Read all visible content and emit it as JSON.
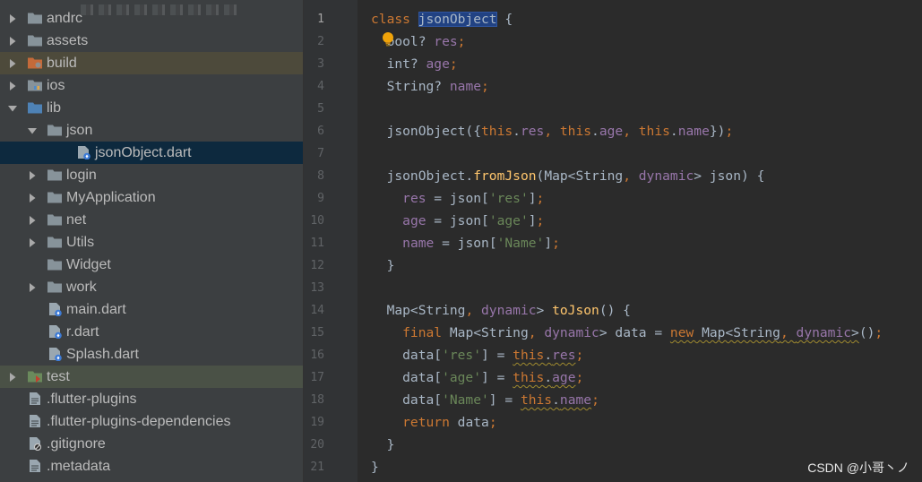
{
  "project_tree": {
    "items": [
      {
        "label": "andrc",
        "arrow": "collapsed",
        "icon": "folder-icon",
        "indent": 0
      },
      {
        "label": "assets",
        "arrow": "collapsed",
        "icon": "folder-icon",
        "indent": 0
      },
      {
        "label": "build",
        "arrow": "collapsed",
        "icon": "excluded-folder-icon",
        "indent": 0,
        "state": "build"
      },
      {
        "label": "ios",
        "arrow": "collapsed",
        "icon": "module-folder-icon",
        "indent": 0
      },
      {
        "label": "lib",
        "arrow": "expanded",
        "icon": "source-folder-icon",
        "indent": 0
      },
      {
        "label": "json",
        "arrow": "expanded",
        "icon": "folder-icon",
        "indent": 1
      },
      {
        "label": "jsonObject.dart",
        "arrow": "none",
        "icon": "dart-file-icon",
        "indent": 2,
        "state": "selected"
      },
      {
        "label": "login",
        "arrow": "collapsed",
        "icon": "folder-icon",
        "indent": 1
      },
      {
        "label": "MyApplication",
        "arrow": "collapsed",
        "icon": "folder-icon",
        "indent": 1
      },
      {
        "label": "net",
        "arrow": "collapsed",
        "icon": "folder-icon",
        "indent": 1
      },
      {
        "label": "Utils",
        "arrow": "collapsed",
        "icon": "folder-icon",
        "indent": 1
      },
      {
        "label": "Widget",
        "arrow": "none",
        "icon": "folder-icon",
        "indent": 1
      },
      {
        "label": "work",
        "arrow": "collapsed",
        "icon": "folder-icon",
        "indent": 1
      },
      {
        "label": "main.dart",
        "arrow": "none",
        "icon": "dart-file-icon",
        "indent": 1
      },
      {
        "label": "r.dart",
        "arrow": "none",
        "icon": "dart-file-icon",
        "indent": 1
      },
      {
        "label": "Splash.dart",
        "arrow": "none",
        "icon": "dart-file-icon",
        "indent": 1
      },
      {
        "label": "test",
        "arrow": "collapsed",
        "icon": "test-folder-icon",
        "indent": 0,
        "state": "test"
      },
      {
        "label": ".flutter-plugins",
        "arrow": "none",
        "icon": "text-file-icon",
        "indent": 0
      },
      {
        "label": ".flutter-plugins-dependencies",
        "arrow": "none",
        "icon": "text-file-icon",
        "indent": 0
      },
      {
        "label": ".gitignore",
        "arrow": "none",
        "icon": "gitignore-file-icon",
        "indent": 0
      },
      {
        "label": ".metadata",
        "arrow": "none",
        "icon": "text-file-icon",
        "indent": 0
      }
    ]
  },
  "editor": {
    "current_line": 1,
    "lines": [
      {
        "n": "1",
        "fold": "open",
        "tokens": [
          [
            "kw",
            "class "
          ],
          [
            "hl",
            "jsonObject"
          ],
          [
            "pl",
            " {"
          ]
        ]
      },
      {
        "n": "2",
        "fold": "",
        "tokens": [
          [
            "pl",
            "  bool? "
          ],
          [
            "fld",
            "res"
          ],
          [
            "kw",
            ";"
          ]
        ]
      },
      {
        "n": "3",
        "fold": "",
        "tokens": [
          [
            "pl",
            "  int? "
          ],
          [
            "fld",
            "age"
          ],
          [
            "kw",
            ";"
          ]
        ]
      },
      {
        "n": "4",
        "fold": "",
        "tokens": [
          [
            "pl",
            "  String? "
          ],
          [
            "fld",
            "name"
          ],
          [
            "kw",
            ";"
          ]
        ]
      },
      {
        "n": "5",
        "fold": "",
        "tokens": []
      },
      {
        "n": "6",
        "fold": "",
        "tokens": [
          [
            "pl",
            "  jsonObject({"
          ],
          [
            "kw",
            "this"
          ],
          [
            "pl",
            "."
          ],
          [
            "fld",
            "res"
          ],
          [
            "kw",
            ", this"
          ],
          [
            "pl",
            "."
          ],
          [
            "fld",
            "age"
          ],
          [
            "kw",
            ", this"
          ],
          [
            "pl",
            "."
          ],
          [
            "fld",
            "name"
          ],
          [
            "pl",
            "})"
          ],
          [
            "kw",
            ";"
          ]
        ]
      },
      {
        "n": "7",
        "fold": "",
        "tokens": []
      },
      {
        "n": "8",
        "fold": "open",
        "tokens": [
          [
            "pl",
            "  jsonObject."
          ],
          [
            "fn",
            "fromJson"
          ],
          [
            "pl",
            "(Map<String"
          ],
          [
            "kw",
            ", "
          ],
          [
            "fld",
            "dynamic"
          ],
          [
            "pl",
            "> json) {"
          ]
        ]
      },
      {
        "n": "9",
        "fold": "",
        "tokens": [
          [
            "pl",
            "    "
          ],
          [
            "fld",
            "res"
          ],
          [
            "pl",
            " = json["
          ],
          [
            "str",
            "'res'"
          ],
          [
            "pl",
            "]"
          ],
          [
            "kw",
            ";"
          ]
        ]
      },
      {
        "n": "10",
        "fold": "",
        "tokens": [
          [
            "pl",
            "    "
          ],
          [
            "fld",
            "age"
          ],
          [
            "pl",
            " = json["
          ],
          [
            "str",
            "'age'"
          ],
          [
            "pl",
            "]"
          ],
          [
            "kw",
            ";"
          ]
        ]
      },
      {
        "n": "11",
        "fold": "",
        "tokens": [
          [
            "pl",
            "    "
          ],
          [
            "fld",
            "name"
          ],
          [
            "pl",
            " = json["
          ],
          [
            "str",
            "'Name'"
          ],
          [
            "pl",
            "]"
          ],
          [
            "kw",
            ";"
          ]
        ]
      },
      {
        "n": "12",
        "fold": "close",
        "tokens": [
          [
            "pl",
            "  }"
          ]
        ]
      },
      {
        "n": "13",
        "fold": "",
        "tokens": []
      },
      {
        "n": "14",
        "fold": "open",
        "tokens": [
          [
            "pl",
            "  Map<String"
          ],
          [
            "kw",
            ", "
          ],
          [
            "fld",
            "dynamic"
          ],
          [
            "pl",
            "> "
          ],
          [
            "fn",
            "toJson"
          ],
          [
            "pl",
            "() {"
          ]
        ]
      },
      {
        "n": "15",
        "fold": "",
        "tokens": [
          [
            "kw",
            "    final "
          ],
          [
            "pl",
            "Map<String"
          ],
          [
            "kw",
            ", "
          ],
          [
            "fld",
            "dynamic"
          ],
          [
            "pl",
            "> data = "
          ],
          [
            "kwu",
            "new "
          ],
          [
            "wv",
            "Map<String"
          ],
          [
            "kwu",
            ", "
          ],
          [
            "fldu",
            "dynamic"
          ],
          [
            "wv",
            ">"
          ],
          [
            "pl",
            "()"
          ],
          [
            "kw",
            ";"
          ]
        ]
      },
      {
        "n": "16",
        "fold": "",
        "tokens": [
          [
            "pl",
            "    data["
          ],
          [
            "str",
            "'res'"
          ],
          [
            "pl",
            "] = "
          ],
          [
            "kwu",
            "this"
          ],
          [
            "wv",
            "."
          ],
          [
            "fldu",
            "res"
          ],
          [
            "kw",
            ";"
          ]
        ]
      },
      {
        "n": "17",
        "fold": "",
        "tokens": [
          [
            "pl",
            "    data["
          ],
          [
            "str",
            "'age'"
          ],
          [
            "pl",
            "] = "
          ],
          [
            "kwu",
            "this"
          ],
          [
            "wv",
            "."
          ],
          [
            "fldu",
            "age"
          ],
          [
            "kw",
            ";"
          ]
        ]
      },
      {
        "n": "18",
        "fold": "",
        "tokens": [
          [
            "pl",
            "    data["
          ],
          [
            "str",
            "'Name'"
          ],
          [
            "pl",
            "] = "
          ],
          [
            "kwu",
            "this"
          ],
          [
            "wv",
            "."
          ],
          [
            "fldu",
            "name"
          ],
          [
            "kw",
            ";"
          ]
        ]
      },
      {
        "n": "19",
        "fold": "",
        "tokens": [
          [
            "kw",
            "    return "
          ],
          [
            "pl",
            "data"
          ],
          [
            "kw",
            ";"
          ]
        ]
      },
      {
        "n": "20",
        "fold": "close",
        "tokens": [
          [
            "pl",
            "  }"
          ]
        ]
      },
      {
        "n": "21",
        "fold": "close",
        "tokens": [
          [
            "pl",
            "}"
          ]
        ]
      }
    ]
  },
  "watermark": "CSDN @小哥丶ノ",
  "colors": {
    "tree_bg": "#3c3f41",
    "editor_bg": "#2b2b2b",
    "gutter_bg": "#313335",
    "selection": "#0d293e",
    "keyword": "#cc7832",
    "field": "#9876aa",
    "string": "#6a8759",
    "function": "#ffc66d",
    "text": "#a9b7c6"
  }
}
